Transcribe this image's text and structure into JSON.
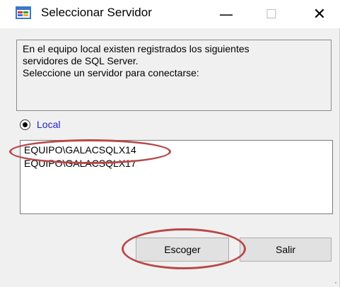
{
  "window": {
    "title": "Seleccionar Servidor",
    "app_icon": "windows-form-icon",
    "controls": {
      "minimize": "—",
      "maximize": "☐",
      "close": "✕"
    }
  },
  "info": {
    "text": "En el equipo local existen registrados los siguientes\nservidores de SQL Server.\nSeleccione un servidor para conectarse:"
  },
  "source": {
    "label": "Local",
    "selected": true
  },
  "servers": [
    "EQUIPO\\GALACSQLX14",
    "EQUIPO\\GALACSQLX17"
  ],
  "buttons": {
    "choose": "Escoger",
    "exit": "Salir"
  },
  "colors": {
    "annotation": "#b84848",
    "link_label": "#1e1ec8"
  }
}
